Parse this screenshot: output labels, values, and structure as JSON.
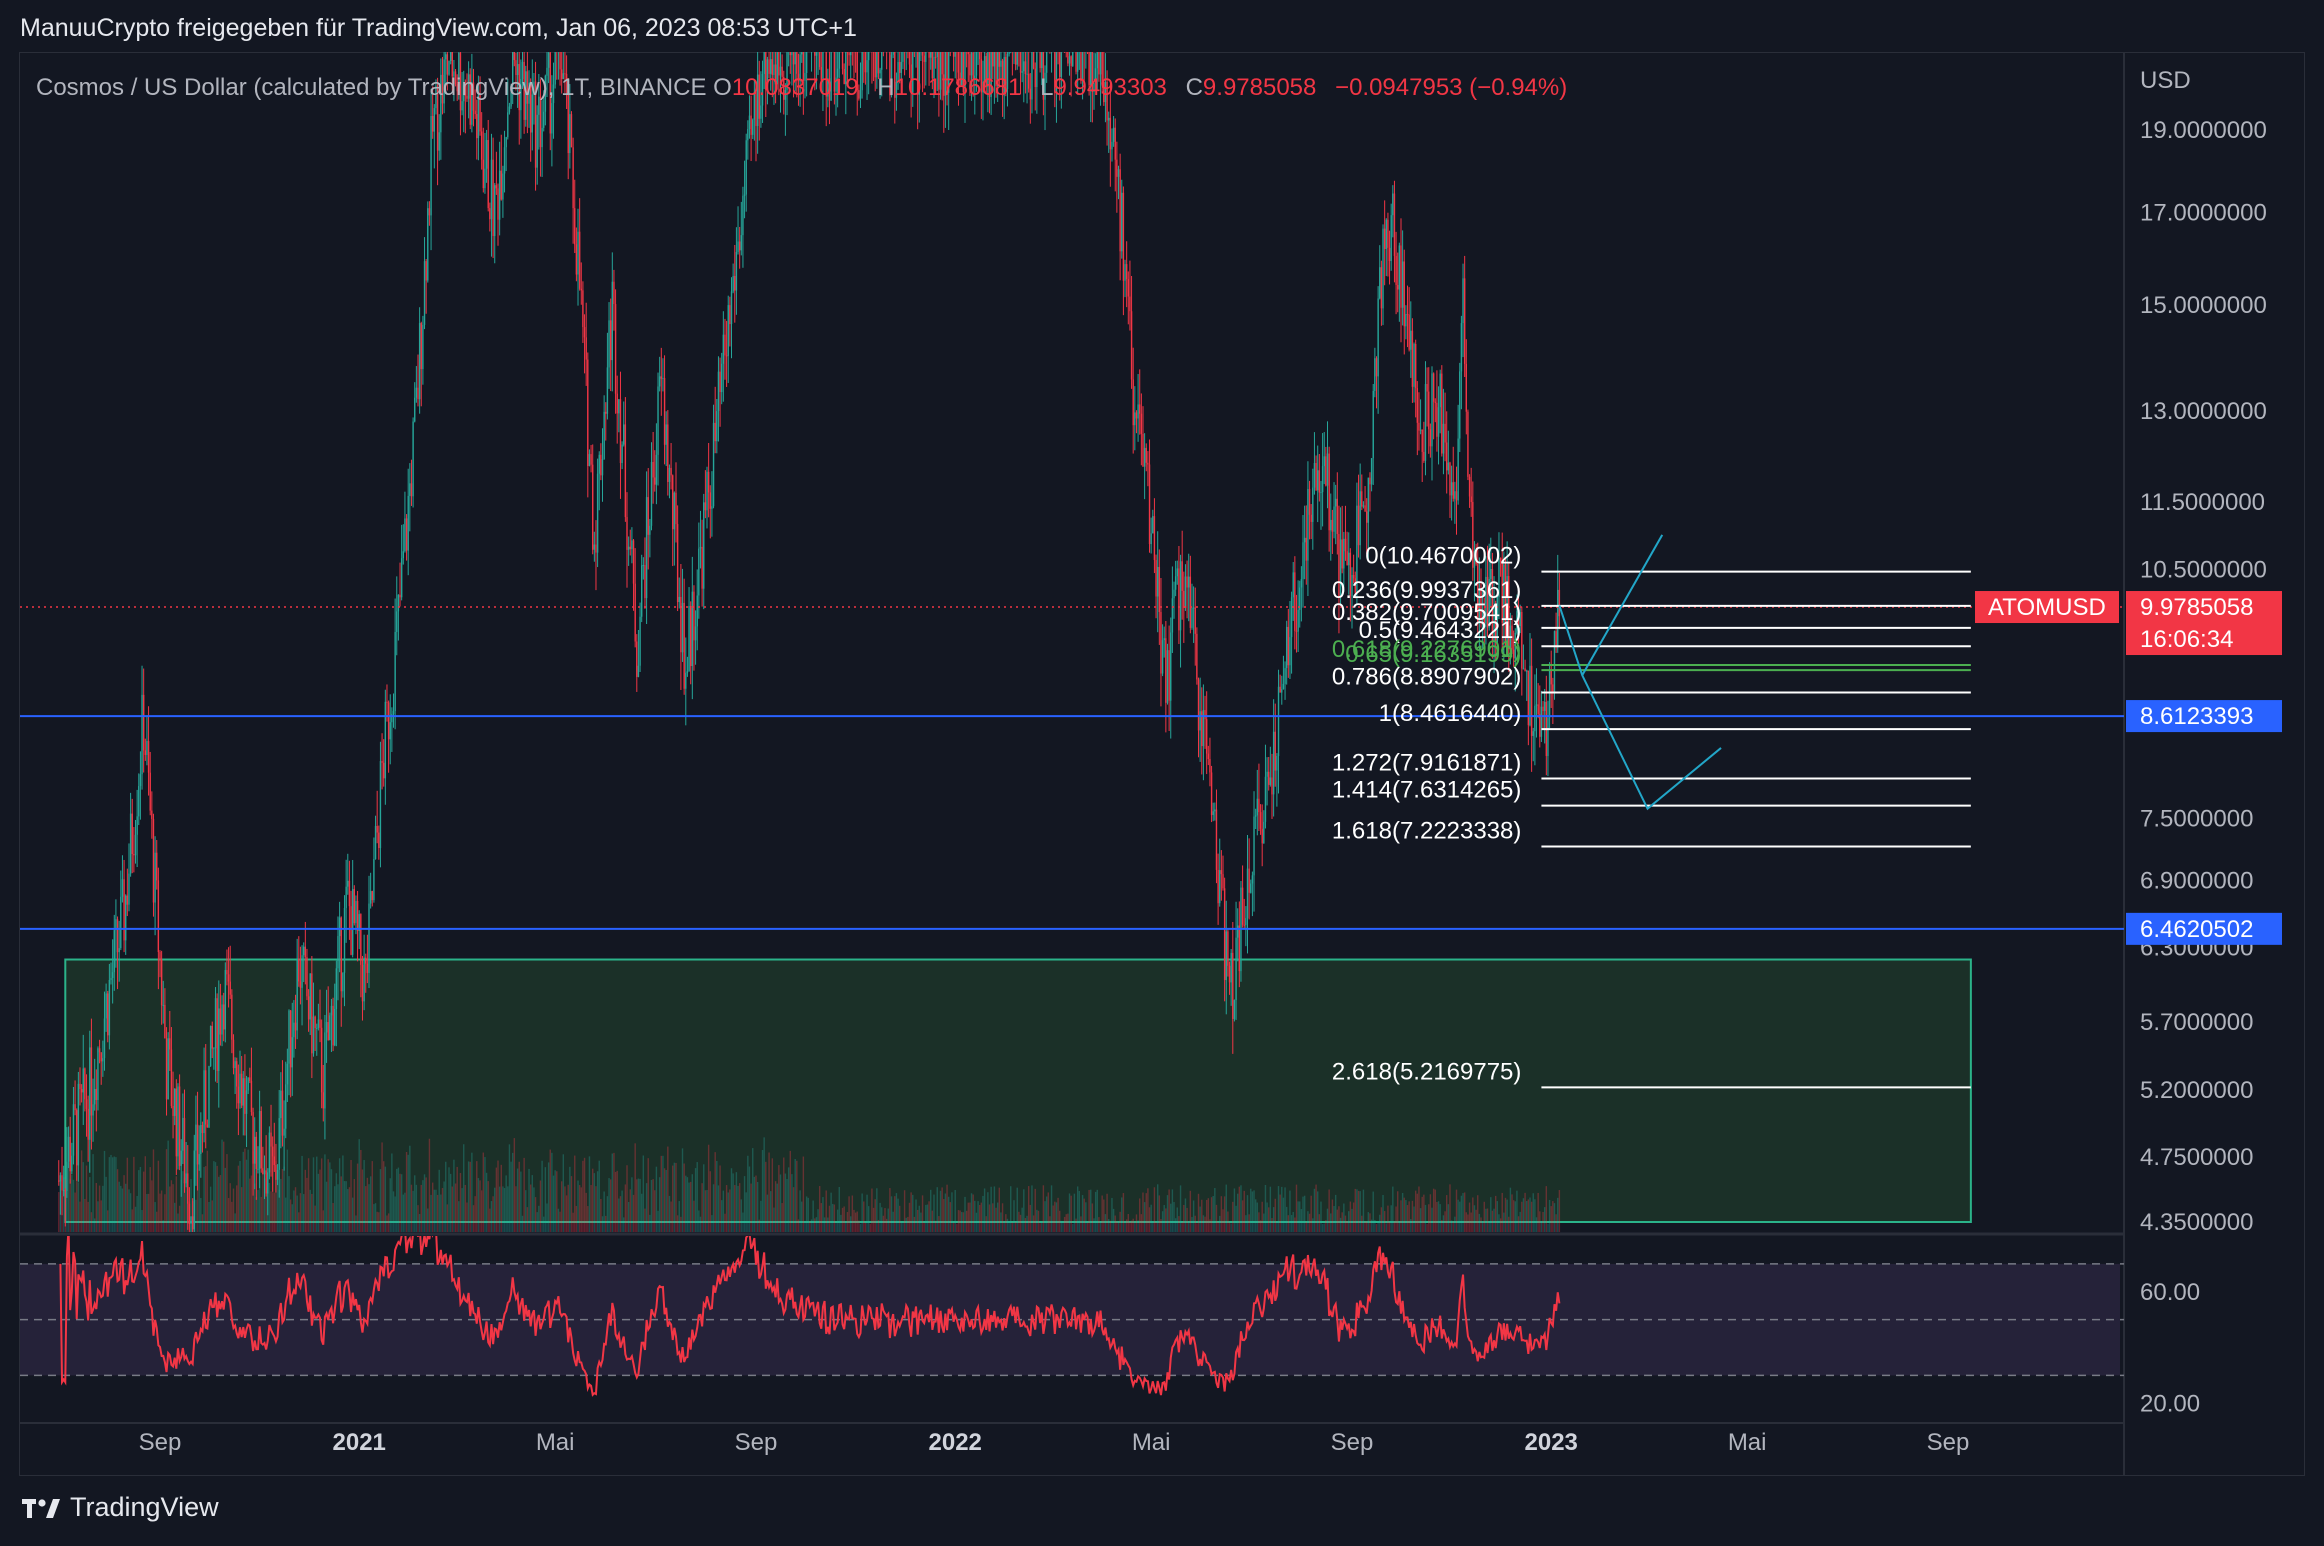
{
  "header": {
    "author_line": "ManuuCrypto freigegeben für TradingView.com, Jan 06, 2023 08:53 UTC+1"
  },
  "legend": {
    "symbol": "Cosmos / US Dollar (calculated by TradingView), 1T, BINANCE",
    "o_key": "O",
    "o_val": "10.0837019",
    "h_key": "H",
    "h_val": "10.1786681",
    "l_key": "L",
    "l_val": "9.9493303",
    "c_key": "C",
    "c_val": "9.9785058",
    "change": "−0.0947953 (−0.94%)"
  },
  "footer": {
    "brand": "TradingView"
  },
  "colors": {
    "background": "#131722",
    "up": "#26a69a",
    "down": "#f23645",
    "fib_line": "#ffffff",
    "blue_line": "#2962ff",
    "projection": "#22a6c8",
    "zone": "#1f3a2b",
    "rsi": "#f23645"
  },
  "chart_data": {
    "type": "candlestick",
    "symbol": "ATOMUSD",
    "currency": "USD",
    "scale": "log",
    "ylim": [
      4.35,
      21.0
    ],
    "y_ticks": [
      "19.0000000",
      "17.0000000",
      "15.0000000",
      "13.0000000",
      "11.5000000",
      "10.5000000",
      "7.5000000",
      "6.9000000",
      "6.3000000",
      "5.7000000",
      "5.2000000",
      "4.7500000",
      "4.3500000"
    ],
    "y_tick_values": [
      19.0,
      17.0,
      15.0,
      13.0,
      11.5,
      10.5,
      7.5,
      6.9,
      6.3,
      5.7,
      5.2,
      4.75,
      4.35
    ],
    "x_ticks": [
      {
        "label": "Sep",
        "bold": false,
        "date": "2020-09-01"
      },
      {
        "label": "2021",
        "bold": true,
        "date": "2021-01-01"
      },
      {
        "label": "Mai",
        "bold": false,
        "date": "2021-05-01"
      },
      {
        "label": "Sep",
        "bold": false,
        "date": "2021-09-01"
      },
      {
        "label": "2022",
        "bold": true,
        "date": "2022-01-01"
      },
      {
        "label": "Mai",
        "bold": false,
        "date": "2022-05-01"
      },
      {
        "label": "Sep",
        "bold": false,
        "date": "2022-09-01"
      },
      {
        "label": "2023",
        "bold": true,
        "date": "2023-01-01"
      },
      {
        "label": "Mai",
        "bold": false,
        "date": "2023-05-01"
      },
      {
        "label": "Sep",
        "bold": false,
        "date": "2023-09-01"
      }
    ],
    "price_path": [
      [
        "2020-07-01",
        4.6
      ],
      [
        "2020-07-20",
        5.2
      ],
      [
        "2020-08-10",
        6.6
      ],
      [
        "2020-08-22",
        8.6
      ],
      [
        "2020-09-05",
        5.4
      ],
      [
        "2020-09-20",
        4.5
      ],
      [
        "2020-10-10",
        6.0
      ],
      [
        "2020-10-25",
        5.0
      ],
      [
        "2020-11-10",
        4.6
      ],
      [
        "2020-11-25",
        6.2
      ],
      [
        "2020-12-10",
        5.3
      ],
      [
        "2020-12-25",
        6.7
      ],
      [
        "2021-01-05",
        6.0
      ],
      [
        "2021-01-15",
        8.0
      ],
      [
        "2021-01-25",
        9.8
      ],
      [
        "2021-02-05",
        13.0
      ],
      [
        "2021-02-15",
        19.0
      ],
      [
        "2021-02-25",
        21.0
      ],
      [
        "2021-03-10",
        20.0
      ],
      [
        "2021-03-25",
        17.0
      ],
      [
        "2021-04-05",
        21.0
      ],
      [
        "2021-04-20",
        19.0
      ],
      [
        "2021-05-05",
        21.0
      ],
      [
        "2021-05-15",
        16.0
      ],
      [
        "2021-05-25",
        11.0
      ],
      [
        "2021-06-05",
        15.0
      ],
      [
        "2021-06-20",
        9.5
      ],
      [
        "2021-07-05",
        13.5
      ],
      [
        "2021-07-20",
        9.2
      ],
      [
        "2021-08-05",
        12.0
      ],
      [
        "2021-08-20",
        16.0
      ],
      [
        "2021-09-05",
        21.0
      ],
      [
        "2021-09-20",
        21.0
      ],
      [
        "2021-12-15",
        21.0
      ],
      [
        "2022-04-01",
        21.0
      ],
      [
        "2022-04-10",
        18.0
      ],
      [
        "2022-04-20",
        13.5
      ],
      [
        "2022-05-01",
        11.0
      ],
      [
        "2022-05-10",
        9.0
      ],
      [
        "2022-05-20",
        10.5
      ],
      [
        "2022-06-01",
        8.7
      ],
      [
        "2022-06-10",
        7.3
      ],
      [
        "2022-06-18",
        5.9
      ],
      [
        "2022-07-01",
        7.0
      ],
      [
        "2022-07-15",
        8.3
      ],
      [
        "2022-07-25",
        9.6
      ],
      [
        "2022-08-05",
        11.2
      ],
      [
        "2022-08-15",
        12.3
      ],
      [
        "2022-08-25",
        10.5
      ],
      [
        "2022-09-01",
        10.4
      ],
      [
        "2022-09-10",
        11.8
      ],
      [
        "2022-09-20",
        15.8
      ],
      [
        "2022-09-25",
        16.8
      ],
      [
        "2022-10-05",
        14.5
      ],
      [
        "2022-10-15",
        12.8
      ],
      [
        "2022-10-25",
        13.2
      ],
      [
        "2022-11-01",
        11.3
      ],
      [
        "2022-11-05",
        12.5
      ],
      [
        "2022-11-08",
        15.5
      ],
      [
        "2022-11-12",
        11.5
      ],
      [
        "2022-11-20",
        9.8
      ],
      [
        "2022-12-01",
        10.1
      ],
      [
        "2022-12-10",
        9.6
      ],
      [
        "2022-12-20",
        8.8
      ],
      [
        "2022-12-28",
        8.5
      ],
      [
        "2023-01-02",
        9.3
      ],
      [
        "2023-01-06",
        9.98
      ]
    ],
    "fib_levels": [
      {
        "label": "0(10.4670002)",
        "ratio": 0,
        "value": 10.4670002
      },
      {
        "label": "0.236(9.9937361)",
        "ratio": 0.236,
        "value": 9.9937361
      },
      {
        "label": "0.382(9.7009541)",
        "ratio": 0.382,
        "value": 9.7009541
      },
      {
        "label": "0.5(9.4643221)",
        "ratio": 0.5,
        "value": 9.4643221
      },
      {
        "label": "0.618(9.2276901)",
        "ratio": 0.618,
        "value": 9.2276901,
        "color": "#4caf50"
      },
      {
        "label": "0.65(9.1635199)",
        "ratio": 0.65,
        "value": 9.1635199,
        "color": "#4caf50"
      },
      {
        "label": "0.786(8.8907902)",
        "ratio": 0.786,
        "value": 8.8907902
      },
      {
        "label": "1(8.4616440)",
        "ratio": 1,
        "value": 8.461644
      },
      {
        "label": "1.272(7.9161871)",
        "ratio": 1.272,
        "value": 7.9161871
      },
      {
        "label": "1.414(7.6314265)",
        "ratio": 1.414,
        "value": 7.6314265
      },
      {
        "label": "1.618(7.2223338)",
        "ratio": 1.618,
        "value": 7.2223338
      },
      {
        "label": "2.618(5.2169775)",
        "ratio": 2.618,
        "value": 5.2169775
      }
    ],
    "fib_range_dates": [
      "2022-12-26",
      "2023-09-15"
    ],
    "horizontal_lines": [
      {
        "value": 8.6123393,
        "label": "8.6123393"
      },
      {
        "value": 6.4620502,
        "label": "6.4620502"
      }
    ],
    "current_price": {
      "symbol_tag": "ATOMUSD",
      "value": "9.9785058",
      "countdown": "16:06:34",
      "numeric": 9.9785058
    },
    "zone": {
      "from_date": "2020-07-05",
      "to_date": "2023-09-15",
      "top": 6.2,
      "bottom": 4.35
    },
    "projection_path": [
      [
        "2023-01-06",
        10.0
      ],
      [
        "2023-01-20",
        9.1
      ],
      [
        "2023-03-01",
        7.6
      ],
      [
        "2023-04-15",
        8.25
      ]
    ],
    "projection_branch": [
      [
        "2023-01-20",
        9.1
      ],
      [
        "2023-03-10",
        11.0
      ]
    ],
    "rsi": {
      "ticks": [
        "60.00",
        "20.00"
      ],
      "tick_values": [
        60,
        20
      ],
      "bands": [
        70,
        50,
        30
      ],
      "ylim": [
        14,
        80
      ],
      "last": 64
    }
  }
}
